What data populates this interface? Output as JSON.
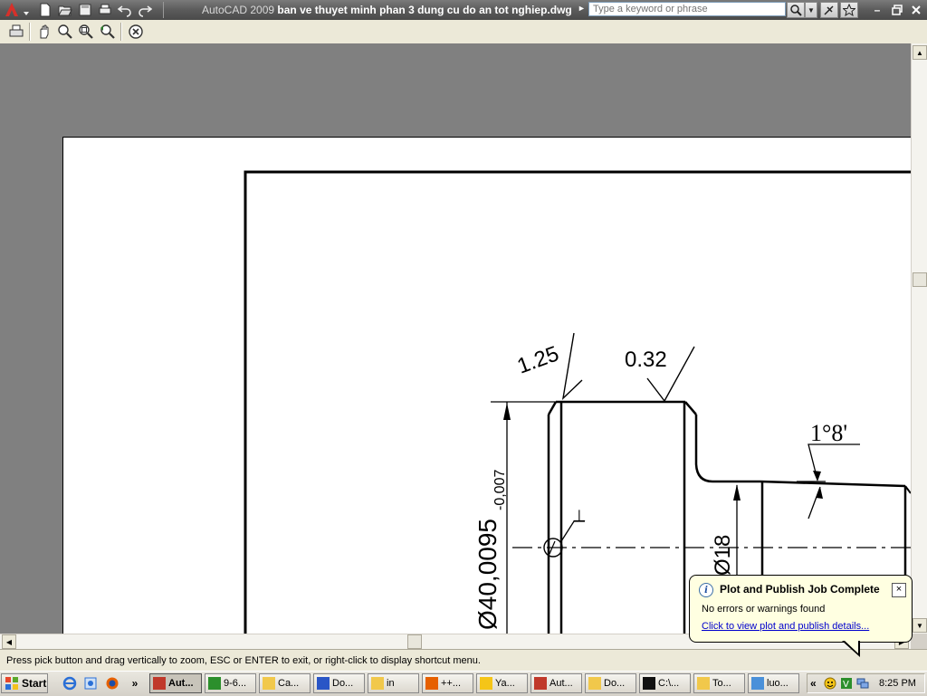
{
  "window": {
    "product": "AutoCAD 2009",
    "filename": "ban ve thuyet minh phan 3 dung cu do an tot nghiep.dwg"
  },
  "search": {
    "placeholder": "Type a keyword or phrase"
  },
  "quick_access": [
    "new-icon",
    "open-icon",
    "save-icon",
    "plot-icon",
    "undo-icon",
    "redo-icon"
  ],
  "preview_toolbar": [
    "plot-icon",
    "pan-icon",
    "zoom-realtime-icon",
    "zoom-window-icon",
    "zoom-previous-icon",
    "close-preview-icon"
  ],
  "drawing": {
    "dim_roughness_left": "1.25",
    "dim_roughness_top": "0.32",
    "dim_angle": "1°8'",
    "dim_diameter_main": "Ø40,0095",
    "dim_tolerance": "-0,007",
    "dim_diameter_small": "Ø18",
    "perp_symbol": "⊥"
  },
  "status": {
    "message": "Press pick button and drag vertically to zoom, ESC or ENTER to exit, or right-click to display shortcut menu."
  },
  "balloon": {
    "title": "Plot and Publish Job Complete",
    "message": "No errors or warnings found",
    "link": "Click to view plot and publish details...",
    "close": "×",
    "info": "i"
  },
  "taskbar": {
    "start": "Start",
    "tasks": [
      {
        "label": "Aut...",
        "icon": "autocad-icon",
        "active": true
      },
      {
        "label": "9-6...",
        "icon": "app-icon"
      },
      {
        "label": "Ca...",
        "icon": "folder-icon"
      },
      {
        "label": "Do...",
        "icon": "word-icon"
      },
      {
        "label": "in",
        "icon": "folder-icon"
      },
      {
        "label": "++...",
        "icon": "firefox-icon"
      },
      {
        "label": "Ya...",
        "icon": "yahoo-icon"
      },
      {
        "label": "Aut...",
        "icon": "pdf-icon"
      },
      {
        "label": "Do...",
        "icon": "folder-icon"
      },
      {
        "label": "C:\\...",
        "icon": "cmd-icon"
      },
      {
        "label": "To...",
        "icon": "folder-icon"
      },
      {
        "label": "luo...",
        "icon": "chat-icon"
      }
    ],
    "more": "»",
    "tray_collapse": "«",
    "clock": "8:25 PM"
  },
  "colors": {
    "titlebar": "#5b5b5b",
    "model_bg": "#808080",
    "balloon_bg": "#ffffe1",
    "link": "#0000cc"
  }
}
